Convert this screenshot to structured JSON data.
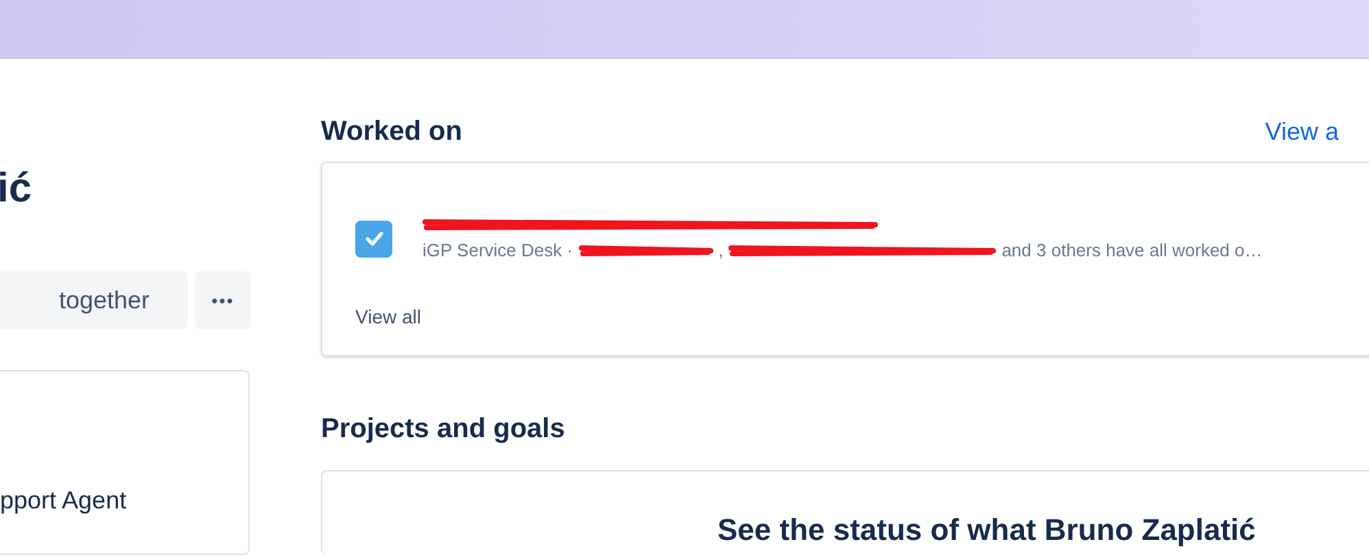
{
  "profile": {
    "name": "ić",
    "action_button": "together",
    "more_button": "•••",
    "role": "pport Agent"
  },
  "worked_on": {
    "title": "Worked on",
    "link": "View a",
    "items": [
      {
        "kind": "task",
        "checked": true,
        "service": "iGP Service Desk ·",
        "separator": ",",
        "suffix": "and 3 others have all worked o…"
      }
    ],
    "view_all": "View all"
  },
  "projects": {
    "title": "Projects and goals",
    "message": "See the status of what Bruno Zaplatić"
  }
}
